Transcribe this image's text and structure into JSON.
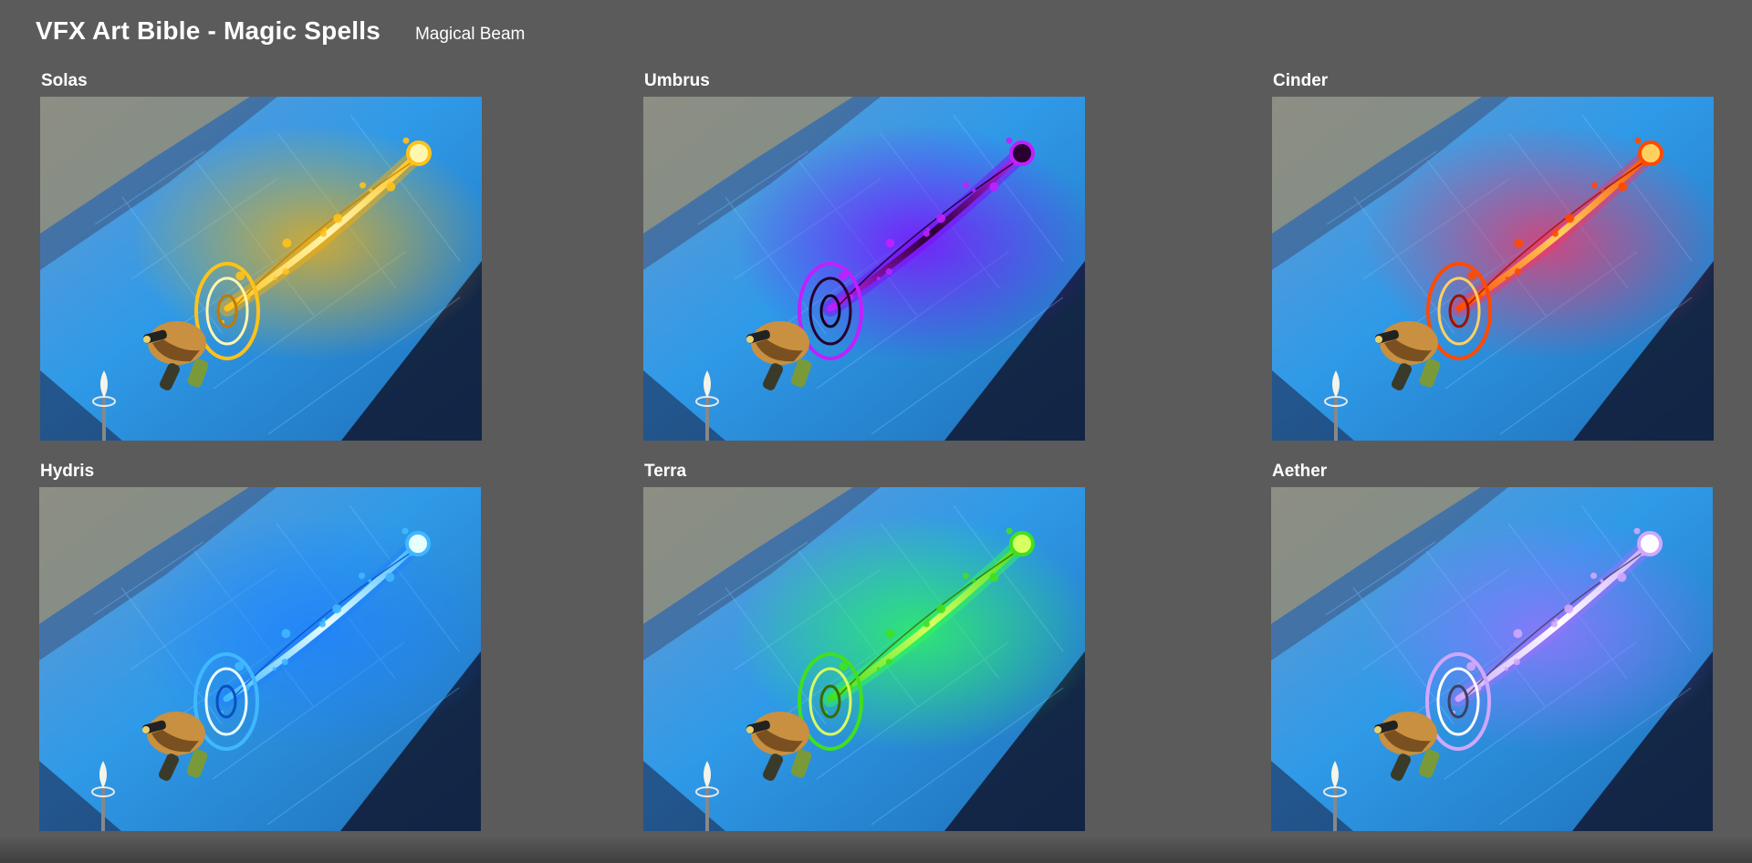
{
  "page": {
    "title": "VFX Art Bible - Magic Spells",
    "subtitle": "Magical Beam"
  },
  "panels": [
    {
      "label": "Solas",
      "colors": {
        "core": "#fff6b0",
        "main": "#ffc21a",
        "glow": "#ffb000",
        "dark": "#c07a00"
      }
    },
    {
      "label": "Umbrus",
      "colors": {
        "core": "#2a0030",
        "main": "#c020ff",
        "glow": "#8a00ff",
        "dark": "#10001a"
      }
    },
    {
      "label": "Cinder",
      "colors": {
        "core": "#ffd060",
        "main": "#ff4a00",
        "glow": "#ff3060",
        "dark": "#a01000"
      }
    },
    {
      "label": "Hydris",
      "colors": {
        "core": "#e8ffff",
        "main": "#40b8ff",
        "glow": "#2080ff",
        "dark": "#0a50c0"
      }
    },
    {
      "label": "Terra",
      "colors": {
        "core": "#d8ff60",
        "main": "#40e020",
        "glow": "#30ff50",
        "dark": "#3a6a00"
      }
    },
    {
      "label": "Aether",
      "colors": {
        "core": "#ffffff",
        "main": "#d0a8ff",
        "glow": "#a070ff",
        "dark": "#404060"
      }
    }
  ]
}
